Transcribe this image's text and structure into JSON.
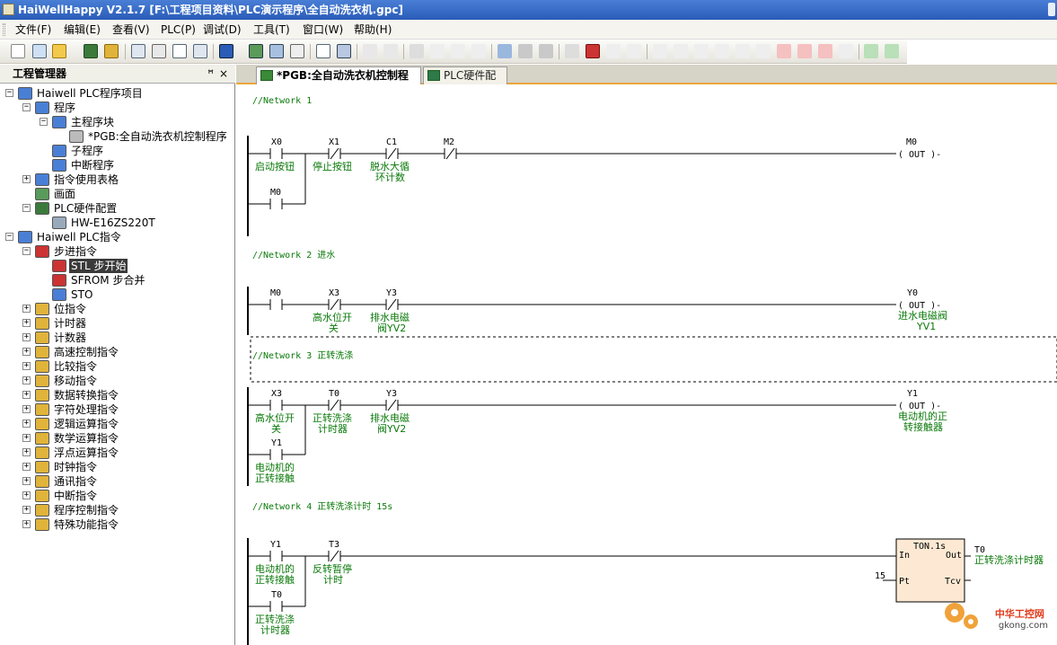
{
  "window": {
    "title": "HaiWellHappy V2.1.7 [F:\\工程项目资料\\PLC演示程序\\全自动洗衣机.gpc]"
  },
  "menu": [
    "文件(F)",
    "编辑(E)",
    "查看(V)",
    "PLC(P)",
    "调试(D)",
    "工具(T)",
    "窗口(W)",
    "帮助(H)"
  ],
  "explorer": {
    "title": "工程管理器",
    "pin": "ꟸ",
    "close": "×",
    "tree": [
      {
        "label": "Haiwell PLC程序项目",
        "exp": "−"
      },
      {
        "label": "程序",
        "exp": "−"
      },
      {
        "label": "主程序块",
        "exp": "−"
      },
      {
        "label": "*PGB:全自动洗衣机控制程序",
        "exp": ""
      },
      {
        "label": "子程序",
        "exp": ""
      },
      {
        "label": "中断程序",
        "exp": ""
      },
      {
        "label": "指令使用表格",
        "exp": "+"
      },
      {
        "label": "画面",
        "exp": ""
      },
      {
        "label": "PLC硬件配置",
        "exp": "−"
      },
      {
        "label": "HW-E16ZS220T",
        "exp": ""
      },
      {
        "label": "Haiwell PLC指令",
        "exp": "−"
      },
      {
        "label": "步进指令",
        "exp": "−"
      },
      {
        "label": "STL 步开始",
        "exp": ""
      },
      {
        "label": "SFROM 步合并",
        "exp": ""
      },
      {
        "label": "STO",
        "exp": ""
      },
      {
        "label": "位指令",
        "exp": "+"
      },
      {
        "label": "计时器",
        "exp": "+"
      },
      {
        "label": "计数器",
        "exp": "+"
      },
      {
        "label": "高速控制指令",
        "exp": "+"
      },
      {
        "label": "比较指令",
        "exp": "+"
      },
      {
        "label": "移动指令",
        "exp": "+"
      },
      {
        "label": "数据转换指令",
        "exp": "+"
      },
      {
        "label": "字符处理指令",
        "exp": "+"
      },
      {
        "label": "逻辑运算指令",
        "exp": "+"
      },
      {
        "label": "数学运算指令",
        "exp": "+"
      },
      {
        "label": "浮点运算指令",
        "exp": "+"
      },
      {
        "label": "时钟指令",
        "exp": "+"
      },
      {
        "label": "通讯指令",
        "exp": "+"
      },
      {
        "label": "中断指令",
        "exp": "+"
      },
      {
        "label": "程序控制指令",
        "exp": "+"
      },
      {
        "label": "特殊功能指令",
        "exp": "+"
      }
    ]
  },
  "tabs": [
    {
      "label": "*PGB:全自动洗衣机控制程序"
    },
    {
      "label": "PLC硬件配置"
    }
  ],
  "networks": [
    {
      "title": "//Network 1"
    },
    {
      "title": "//Network 2  进水"
    },
    {
      "title": "//Network 3  正转洗涤"
    },
    {
      "title": "//Network 4  正转洗涤计时  15s"
    }
  ],
  "ladder_text": {
    "n1": {
      "x0": "X0",
      "x0c": "启动按钮",
      "x1": "X1",
      "x1c": "停止按钮",
      "c1": "C1",
      "c1c1": "脱水大循",
      "c1c2": "环计数",
      "m2": "M2",
      "m0b": "M0",
      "m0": "M0",
      "out": "( OUT )-"
    },
    "n2": {
      "m0": "M0",
      "x3": "X3",
      "x3c1": "高水位开",
      "x3c2": "关",
      "y3": "Y3",
      "y3c1": "排水电磁",
      "y3c2": "阀YV2",
      "y0": "Y0",
      "out": "( OUT )-",
      "y0c1": "进水电磁阀",
      "y0c2": "YV1"
    },
    "n3": {
      "x3": "X3",
      "x3c1": "高水位开",
      "x3c2": "关",
      "t0": "T0",
      "t0c1": "正转洗涤",
      "t0c2": "计时器",
      "y3": "Y3",
      "y3c1": "排水电磁",
      "y3c2": "阀YV2",
      "y1b": "Y1",
      "y1bc1": "电动机的",
      "y1bc2": "正转接触",
      "y1": "Y1",
      "out": "( OUT )-",
      "y1c1": "电动机的正",
      "y1c2": "转接触器"
    },
    "n4": {
      "y1": "Y1",
      "y1c1": "电动机的",
      "y1c2": "正转接触",
      "t3": "T3",
      "t3c1": "反转暂停",
      "t3c2": "计时",
      "t0b": "T0",
      "t0bc1": "正转洗涤",
      "t0bc2": "计时器",
      "ton": "TON.1s",
      "in": "In",
      "outp": "Out",
      "pt": "Pt",
      "tcv": "Tcv",
      "pt_val": "15",
      "t0": "T0",
      "t0c": "正转洗涤计时器"
    }
  },
  "watermark": {
    "cn": "中华工控网",
    "url": "gkong.com"
  }
}
